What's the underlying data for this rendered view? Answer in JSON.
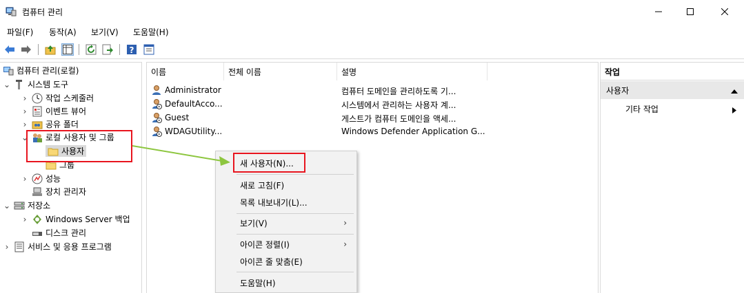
{
  "window": {
    "title": "컴퓨터 관리",
    "controls": {
      "minimize": "minimize-icon",
      "maximize": "maximize-icon",
      "close": "close-icon"
    }
  },
  "menubar": [
    "파일(F)",
    "동작(A)",
    "보기(V)",
    "도움말(H)"
  ],
  "toolbar": [
    "back-arrow-icon",
    "forward-arrow-icon",
    "up-folder-icon",
    "show-hide-tree-icon",
    "refresh-icon",
    "export-list-icon",
    "help-icon",
    "properties-icon"
  ],
  "tree": {
    "root": "컴퓨터 관리(로컬)",
    "system_tools": "시스템 도구",
    "task_scheduler": "작업 스케줄러",
    "event_viewer": "이벤트 뷰어",
    "shared_folders": "공유 폴더",
    "local_users_groups": "로컬 사용자 및 그룹",
    "users": "사용자",
    "groups": "그룹",
    "performance": "성능",
    "device_manager": "장치 관리자",
    "storage": "저장소",
    "windows_server_backup": "Windows Server 백업",
    "disk_management": "디스크 관리",
    "services_apps": "서비스 및 응용 프로그램"
  },
  "list": {
    "columns": [
      "이름",
      "전체 이름",
      "설명"
    ],
    "rows": [
      {
        "name": "Administrator",
        "full_name": "",
        "description": "컴퓨터 도메인을 관리하도록 기..."
      },
      {
        "name": "DefaultAcco...",
        "full_name": "",
        "description": "시스템에서 관리하는 사용자 계..."
      },
      {
        "name": "Guest",
        "full_name": "",
        "description": "게스트가 컴퓨터 도메인을 액세..."
      },
      {
        "name": "WDAGUtility...",
        "full_name": "",
        "description": "Windows Defender Application G..."
      }
    ]
  },
  "actions": {
    "header": "작업",
    "section": "사용자",
    "more": "기타 작업"
  },
  "context_menu": {
    "new_user": "새 사용자(N)...",
    "refresh": "새로 고침(F)",
    "export_list": "목록 내보내기(L)...",
    "view": "보기(V)",
    "arrange_icons": "아이콘 정렬(I)",
    "line_up_icons": "아이콘 줄 맞춤(E)",
    "help": "도움말(H)"
  },
  "colors": {
    "highlight": "#e8141e",
    "arrow": "#8dc63f",
    "action_section_bg": "#e8e8e8"
  }
}
